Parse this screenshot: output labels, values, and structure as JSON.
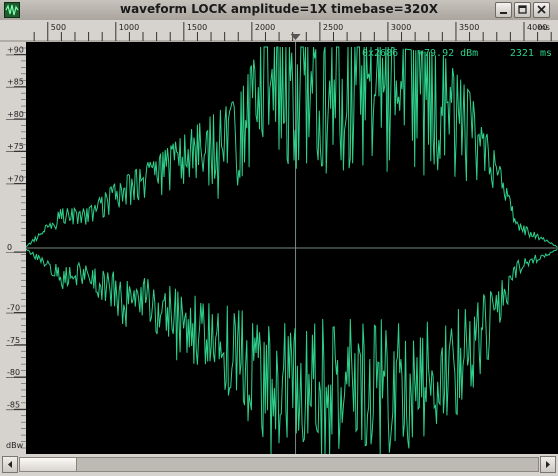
{
  "window": {
    "title": "waveform  LOCK amplitude=1X timebase=320X",
    "controls": [
      "minimize",
      "maximize",
      "close"
    ]
  },
  "time_ruler": {
    "unit": "ms",
    "ticks": [
      {
        "label": "500",
        "value": 500
      },
      {
        "label": "1000",
        "value": 1000
      },
      {
        "label": "1500",
        "value": 1500
      },
      {
        "label": "2000",
        "value": 2000
      },
      {
        "label": "2500",
        "value": 2500
      },
      {
        "label": "3000",
        "value": 3000
      },
      {
        "label": "3500",
        "value": 3500
      },
      {
        "label": "4000",
        "value": 4000
      }
    ],
    "start": 340,
    "end": 4250
  },
  "amplitude_axis": {
    "unit_label": "dBw",
    "ticks_upper": [
      {
        "label": "+90",
        "value": 90
      },
      {
        "label": "+85",
        "value": 85
      },
      {
        "label": "+80",
        "value": 80
      },
      {
        "label": "+75",
        "value": 75
      },
      {
        "label": "+70",
        "value": 70
      }
    ],
    "zero_label": "0",
    "ticks_lower": [
      {
        "label": "-70",
        "value": 70
      },
      {
        "label": "-75",
        "value": 75
      },
      {
        "label": "-80",
        "value": 80
      },
      {
        "label": "-85",
        "value": 85
      }
    ]
  },
  "readouts": {
    "frequency": "0x2686",
    "level": "+79.92 dBm",
    "time": "2321 ms"
  },
  "cursor": {
    "time_ms": 2321
  },
  "waveform": {
    "color": "#2fd08a",
    "envelope": [
      {
        "t": 340,
        "db": 60
      },
      {
        "t": 600,
        "db": 66
      },
      {
        "t": 800,
        "db": 66
      },
      {
        "t": 1000,
        "db": 70
      },
      {
        "t": 1300,
        "db": 74
      },
      {
        "t": 1600,
        "db": 79
      },
      {
        "t": 1900,
        "db": 83
      },
      {
        "t": 2050,
        "db": 91
      },
      {
        "t": 2500,
        "db": 91
      },
      {
        "t": 3000,
        "db": 91
      },
      {
        "t": 3400,
        "db": 90
      },
      {
        "t": 3600,
        "db": 84
      },
      {
        "t": 3800,
        "db": 74
      },
      {
        "t": 3950,
        "db": 64
      },
      {
        "t": 4250,
        "db": 60
      }
    ]
  },
  "scrollbar": {
    "position": 0.0,
    "visible_fraction": 0.11
  }
}
